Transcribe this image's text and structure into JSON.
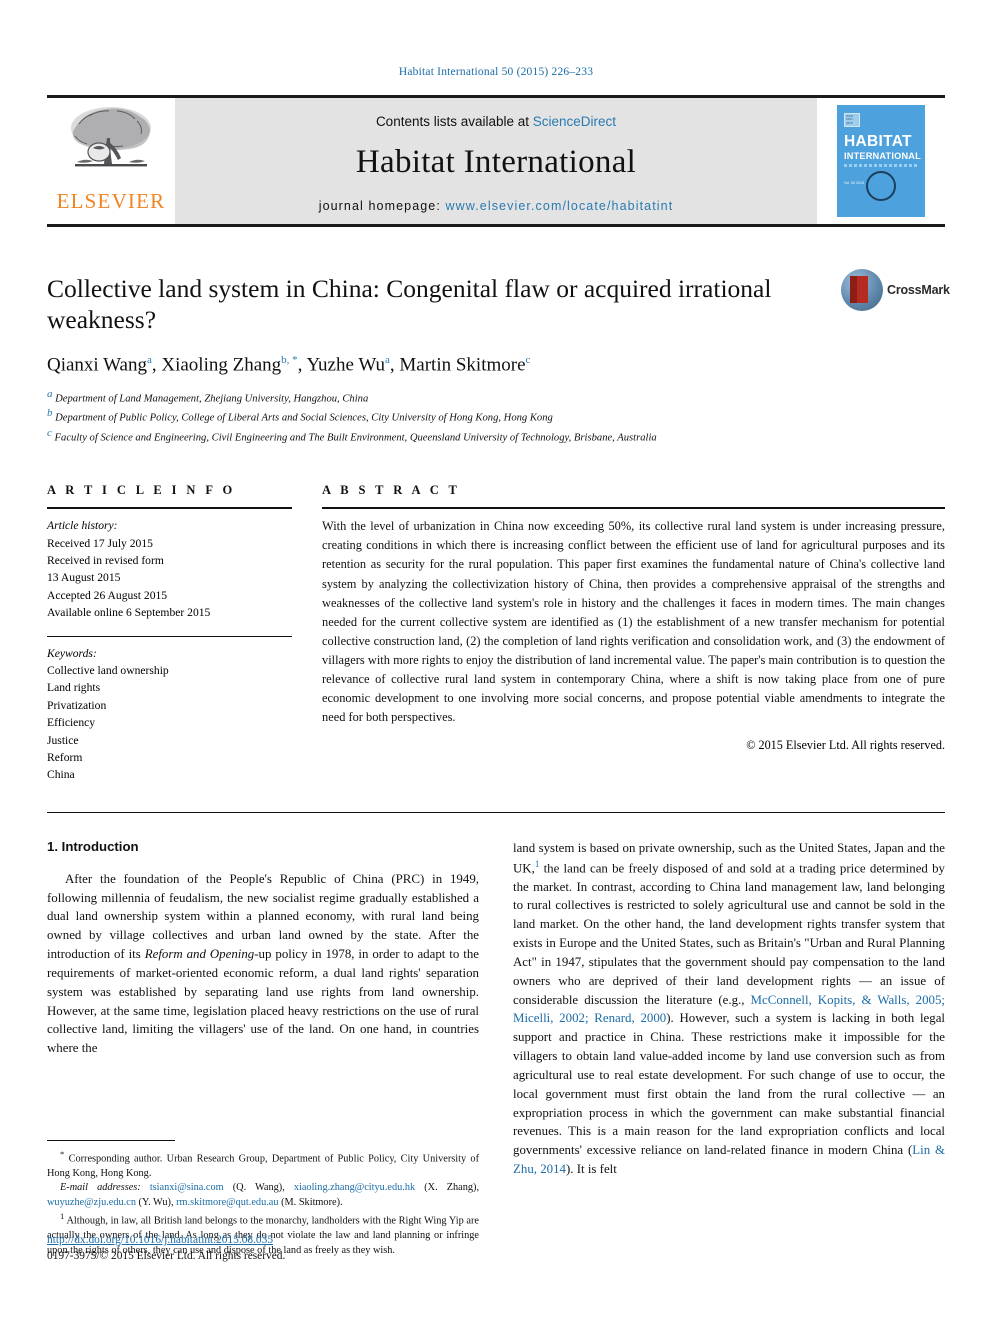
{
  "running_head": "Habitat International 50 (2015) 226–233",
  "banner": {
    "contents_prefix": "Contents lists available at ",
    "sciencedirect": "ScienceDirect",
    "journal_title": "Habitat International",
    "homepage_prefix": "journal homepage: ",
    "homepage_url": "www.elsevier.com/locate/habitatint",
    "publisher_wordmark": "ELSEVIER",
    "cover": {
      "title_line1": "HABITAT",
      "title_line2": "INTERNATIONAL",
      "badge_text": "ISSN 0197-3975",
      "small_text": "Vol. 50\n2015"
    },
    "accent_link_color": "#2a7ab0",
    "elsevier_orange": "#f08421",
    "cover_blue": "#4da2dd"
  },
  "crossmark": {
    "label": "CrossMark"
  },
  "article": {
    "title": "Collective land system in China: Congenital flaw or acquired irrational weakness?",
    "authors": [
      {
        "name": "Qianxi Wang",
        "marks": "a"
      },
      {
        "name": "Xiaoling Zhang",
        "marks": "b, *"
      },
      {
        "name": "Yuzhe Wu",
        "marks": "a"
      },
      {
        "name": "Martin Skitmore",
        "marks": "c"
      }
    ],
    "affiliations": [
      {
        "mark": "a",
        "text": "Department of Land Management, Zhejiang University, Hangzhou, China"
      },
      {
        "mark": "b",
        "text": "Department of Public Policy, College of Liberal Arts and Social Sciences, City University of Hong Kong, Hong Kong"
      },
      {
        "mark": "c",
        "text": "Faculty of Science and Engineering, Civil Engineering and The Built Environment, Queensland University of Technology, Brisbane, Australia"
      }
    ]
  },
  "info": {
    "heading": "A R T I C L E  I N F O",
    "history_label": "Article history:",
    "history": [
      "Received 17 July 2015",
      "Received in revised form",
      "13 August 2015",
      "Accepted 26 August 2015",
      "Available online 6 September 2015"
    ],
    "keywords_label": "Keywords:",
    "keywords": [
      "Collective land ownership",
      "Land rights",
      "Privatization",
      "Efficiency",
      "Justice",
      "Reform",
      "China"
    ]
  },
  "abstract": {
    "heading": "A B S T R A C T",
    "text": "With the level of urbanization in China now exceeding 50%, its collective rural land system is under increasing pressure, creating conditions in which there is increasing conflict between the efficient use of land for agricultural purposes and its retention as security for the rural population. This paper first examines the fundamental nature of China's collective land system by analyzing the collectivization history of China, then provides a comprehensive appraisal of the strengths and weaknesses of the collective land system's role in history and the challenges it faces in modern times. The main changes needed for the current collective system are identified as (1) the establishment of a new transfer mechanism for potential collective construction land, (2) the completion of land rights verification and consolidation work, and (3) the endowment of villagers with more rights to enjoy the distribution of land incremental value. The paper's main contribution is to question the relevance of collective rural land system in contemporary China, where a shift is now taking place from one of pure economic development to one involving more social concerns, and propose potential viable amendments to integrate the need for both perspectives.",
    "copyright": "© 2015 Elsevier Ltd. All rights reserved."
  },
  "body": {
    "section_number_title": "1. Introduction",
    "left_paragraph_1": "After the foundation of the People's Republic of China (PRC) in 1949, following millennia of feudalism, the new socialist regime gradually established a dual land ownership system within a planned economy, with rural land being owned by village collectives and urban land owned by the state. After the introduction of its ",
    "left_paragraph_1_italic": "Reform and Opening",
    "left_paragraph_1_cont": "-up policy in 1978, in order to adapt to the requirements of market-oriented economic reform, a dual land rights' separation system was established by separating land use rights from land ownership. However, at the same time, legislation placed heavy restrictions on the use of rural collective land, limiting the villagers' use of the land. On one hand, in countries where the",
    "right_part_1": "land system is based on private ownership, such as the United States, Japan and the UK,",
    "right_footnote_mark": "1",
    "right_part_2": " the land can be freely disposed of and sold at a trading price determined by the market. In contrast, according to China land management law, land belonging to rural collectives is restricted to solely agricultural use and cannot be sold in the land market. On the other hand, the land development rights transfer system that exists in Europe and the United States, such as Britain's \"Urban and Rural Planning Act\" in 1947, stipulates that the government should pay compensation to the land owners who are deprived of their land development rights — an issue of considerable discussion the literature (e.g., ",
    "right_citation_1": "McConnell, Kopits, & Walls, 2005; Micelli, 2002; Renard, 2000",
    "right_part_3": "). However, such a system is lacking in both legal support and practice in China. These restrictions make it impossible for the villagers to obtain land value-added income by land use conversion such as from agricultural use to real estate development. For such change of use to occur, the local government must first obtain the land from the rural collective — an expropriation process in which the government can make substantial financial revenues. This is a main reason for the land expropriation conflicts and local governments' excessive reliance on land-related finance in modern China (",
    "right_citation_2": "Lin & Zhu, 2014",
    "right_part_4": "). It is felt"
  },
  "footnotes": {
    "corresponding_mark": "*",
    "corresponding": " Corresponding author. Urban Research Group, Department of Public Policy, City University of Hong Kong, Hong Kong.",
    "email_label": "E-mail addresses:",
    "emails": [
      {
        "address": "tsianxi@sina.com",
        "owner": "(Q. Wang)"
      },
      {
        "address": "xiaoling.zhang@cityu.edu.hk",
        "owner": "(X. Zhang)"
      },
      {
        "address": "wuyuzhe@zju.edu.cn",
        "owner": "(Y. Wu)"
      },
      {
        "address": "rm.skitmore@qut.edu.au",
        "owner": "(M. Skitmore)."
      }
    ],
    "note_1_mark": "1",
    "note_1": " Although, in law, all British land belongs to the monarchy, landholders with the Right Wing Yip are actually the owners of the land. As long as they do not violate the law and land planning or infringe upon the rights of others, they can use and dispose of the land as freely as they wish."
  },
  "footer": {
    "doi": "http://dx.doi.org/10.1016/j.habitatint.2015.08.035",
    "issn_line": "0197-3975/© 2015 Elsevier Ltd. All rights reserved."
  }
}
